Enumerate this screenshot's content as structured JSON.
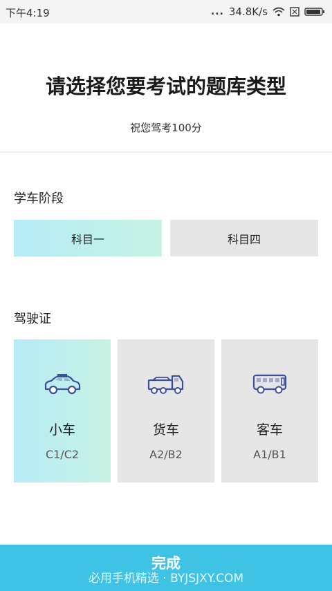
{
  "status_bar": {
    "time": "下午4:19",
    "dots": "...",
    "speed": "34.8K/s"
  },
  "header": {
    "title": "请选择您要考试的题库类型",
    "subtitle": "祝您驾考100分"
  },
  "stage_section": {
    "title": "学车阶段",
    "options": [
      {
        "label": "科目一",
        "selected": true
      },
      {
        "label": "科目四",
        "selected": false
      }
    ]
  },
  "license_section": {
    "title": "驾驶证",
    "options": [
      {
        "name": "小车",
        "code": "C1/C2",
        "icon": "car-icon",
        "selected": true
      },
      {
        "name": "货车",
        "code": "A2/B2",
        "icon": "truck-icon",
        "selected": false
      },
      {
        "name": "客车",
        "code": "A1/B1",
        "icon": "bus-icon",
        "selected": false
      }
    ]
  },
  "footer": {
    "done_label": "完成",
    "watermark": "必用手机精选 · BYJSJXY.COM"
  },
  "colors": {
    "accent": "#3ec3e4",
    "selected_gradient_start": "#b7ebf7",
    "selected_gradient_end": "#c6f3e3",
    "unselected_bg": "#e6e6e6",
    "icon_color": "#3d4f9a"
  }
}
